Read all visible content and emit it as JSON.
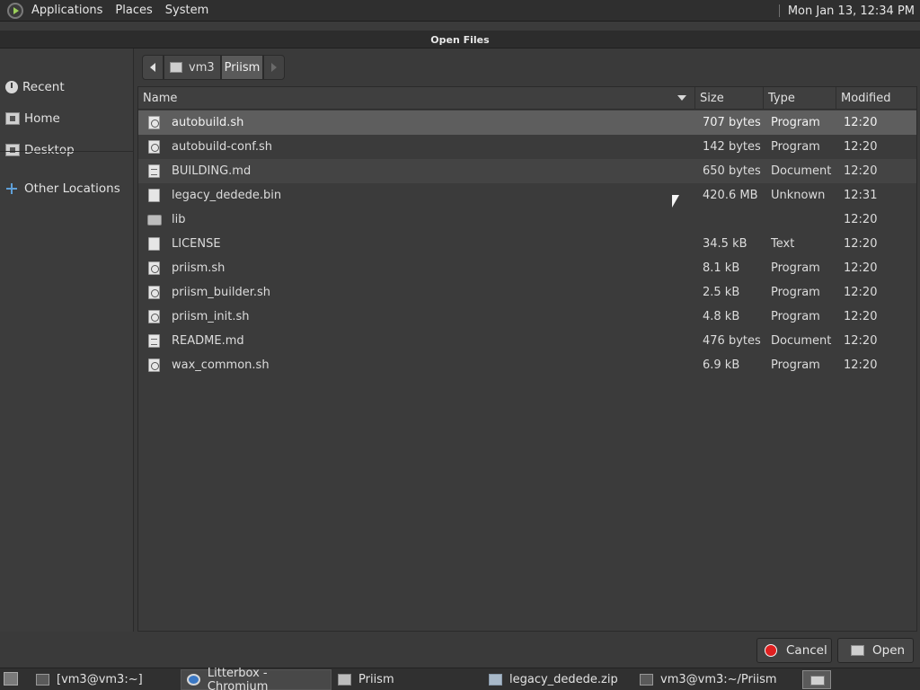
{
  "top_panel": {
    "menu": [
      "Applications",
      "Places",
      "System"
    ],
    "clock": "Mon Jan 13, 12:34 PM"
  },
  "dialog": {
    "title": "Open Files",
    "sidebar": [
      {
        "label": "Recent",
        "icon": "recent-icon"
      },
      {
        "label": "Home",
        "icon": "home-icon"
      },
      {
        "label": "Desktop",
        "icon": "desktop-icon"
      },
      {
        "label": "Other Locations",
        "icon": "plus-icon"
      }
    ],
    "pathbar": {
      "home": "vm3",
      "current": "Priism"
    },
    "columns": {
      "name": "Name",
      "size": "Size",
      "type": "Type",
      "modified": "Modified"
    },
    "files": [
      {
        "name": "autobuild.sh",
        "size": "707 bytes",
        "type": "Program",
        "modified": "12:20",
        "icon": "program-file-icon"
      },
      {
        "name": "autobuild-conf.sh",
        "size": "142 bytes",
        "type": "Program",
        "modified": "12:20",
        "icon": "program-file-icon"
      },
      {
        "name": "BUILDING.md",
        "size": "650 bytes",
        "type": "Document",
        "modified": "12:20",
        "icon": "document-file-icon"
      },
      {
        "name": "legacy_dedede.bin",
        "size": "420.6 MB",
        "type": "Unknown",
        "modified": "12:31",
        "icon": "file-icon"
      },
      {
        "name": "lib",
        "size": "",
        "type": "",
        "modified": "12:20",
        "icon": "folder-icon"
      },
      {
        "name": "LICENSE",
        "size": "34.5 kB",
        "type": "Text",
        "modified": "12:20",
        "icon": "file-icon"
      },
      {
        "name": "priism.sh",
        "size": "8.1 kB",
        "type": "Program",
        "modified": "12:20",
        "icon": "program-file-icon"
      },
      {
        "name": "priism_builder.sh",
        "size": "2.5 kB",
        "type": "Program",
        "modified": "12:20",
        "icon": "program-file-icon"
      },
      {
        "name": "priism_init.sh",
        "size": "4.8 kB",
        "type": "Program",
        "modified": "12:20",
        "icon": "program-file-icon"
      },
      {
        "name": "README.md",
        "size": "476 bytes",
        "type": "Document",
        "modified": "12:20",
        "icon": "document-file-icon"
      },
      {
        "name": "wax_common.sh",
        "size": "6.9 kB",
        "type": "Program",
        "modified": "12:20",
        "icon": "program-file-icon"
      }
    ],
    "buttons": {
      "cancel": "Cancel",
      "open": "Open"
    }
  },
  "taskbar": {
    "tasks": [
      {
        "label": "[vm3@vm3:~]",
        "icon": "terminal-icon"
      },
      {
        "label": "Litterbox - Chromium",
        "icon": "chromium-icon"
      },
      {
        "label": "Priism",
        "icon": "folder-icon"
      },
      {
        "label": "legacy_dedede.zip",
        "icon": "archive-icon"
      },
      {
        "label": "vm3@vm3:~/Priism",
        "icon": "terminal-icon"
      }
    ]
  }
}
